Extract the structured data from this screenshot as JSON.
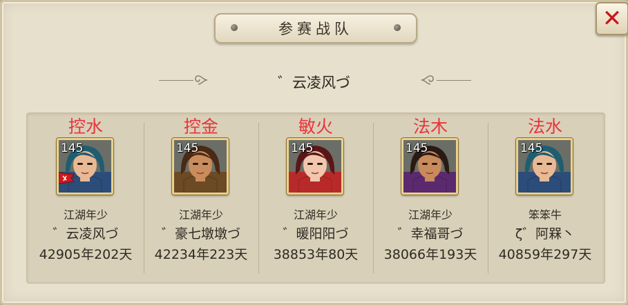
{
  "dialog": {
    "title": "参赛战队",
    "close_label": "✕"
  },
  "team": {
    "name": "゛云凌风づ"
  },
  "members": [
    {
      "role": "控水",
      "level": "145",
      "line1": "江湖年少",
      "line2": "゛云凌风づ",
      "line3": "42905年202天",
      "is_captain": true,
      "hair": "#1f5d70",
      "skin": "#e8b995",
      "cloth": "#2c4c7a"
    },
    {
      "role": "控金",
      "level": "145",
      "line1": "江湖年少",
      "line2": "゛豪七墩墩づ",
      "line3": "42234年223天",
      "is_captain": false,
      "hair": "#4a2a14",
      "skin": "#c98c5c",
      "cloth": "#6b4a24"
    },
    {
      "role": "敏火",
      "level": "145",
      "line1": "江湖年少",
      "line2": "゛暖阳阳づ",
      "line3": "38853年80天",
      "is_captain": false,
      "hair": "#5a1616",
      "skin": "#f2c7ad",
      "cloth": "#b82a2a"
    },
    {
      "role": "法木",
      "level": "145",
      "line1": "江湖年少",
      "line2": "゛幸福哥づ",
      "line3": "38066年193天",
      "is_captain": false,
      "hair": "#2a1a14",
      "skin": "#c98a5c",
      "cloth": "#5b2a6e"
    },
    {
      "role": "法水",
      "level": "145",
      "line1": "笨笨牛",
      "line2": "ζ゛阿槑丶",
      "line3": "40859年297天",
      "is_captain": false,
      "hair": "#1f5d70",
      "skin": "#e8b995",
      "cloth": "#2c4c7a"
    }
  ]
}
